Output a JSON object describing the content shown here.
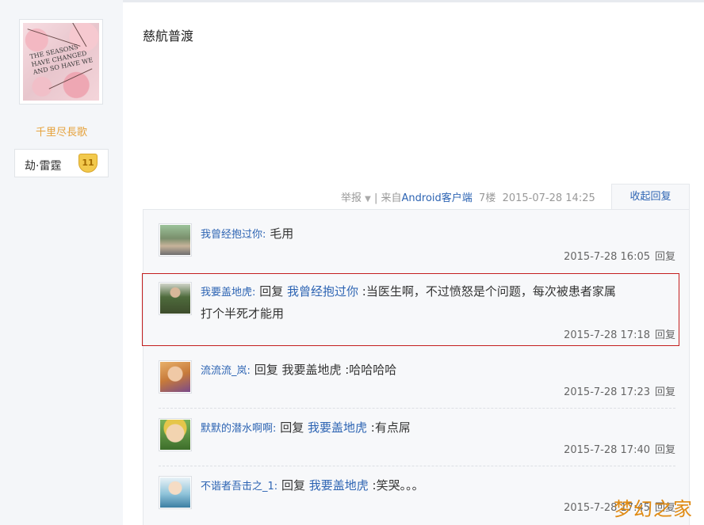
{
  "author": {
    "avatar_text": "The seasons have changed and so have we",
    "username": "千里尽長歌",
    "badge_label": "劫·雷霆",
    "badge_level": "11"
  },
  "post": {
    "content": "慈航普渡",
    "report": "举报",
    "source_prefix": "| 来自",
    "source": "Android客户端",
    "floor": "7楼",
    "time": "2015-07-28 14:25",
    "collapse_label": "收起回复"
  },
  "replies": [
    {
      "user": "我曾经抱过你",
      "sep": ":",
      "prefix": "",
      "target": "",
      "text": "毛用",
      "time": "2015-7-28 16:05",
      "reply_label": "回复"
    },
    {
      "user": "我要盖地虎",
      "sep": ":",
      "prefix": "回复",
      "target": "我曾经抱过你",
      "text": ":当医生啊，不过愤怒是个问题，每次被患者家属",
      "text2": "打个半死才能用",
      "time": "2015-7-28 17:18",
      "reply_label": "回复"
    },
    {
      "user": "流流流_岚",
      "sep": ":",
      "prefix": "回复 我要盖地虎 :哈哈哈哈",
      "target": "",
      "text": "",
      "time": "2015-7-28 17:23",
      "reply_label": "回复"
    },
    {
      "user": "默默的潜水啊啊",
      "sep": ":",
      "prefix": "回复",
      "target": "我要盖地虎",
      "text": ":有点屌",
      "time": "2015-7-28 17:40",
      "reply_label": "回复"
    },
    {
      "user": "不谐者吾击之_1",
      "sep": ":",
      "prefix": "回复",
      "target": "我要盖地虎",
      "text": ":笑哭。。。",
      "time": "2015-7-28 17:45",
      "reply_label": "回复"
    }
  ],
  "watermark": "梦幻之家",
  "colors": {
    "link": "#2d64b3",
    "username": "#e6a23c",
    "highlight": "#c41e1e",
    "watermark": "#e08a12"
  }
}
